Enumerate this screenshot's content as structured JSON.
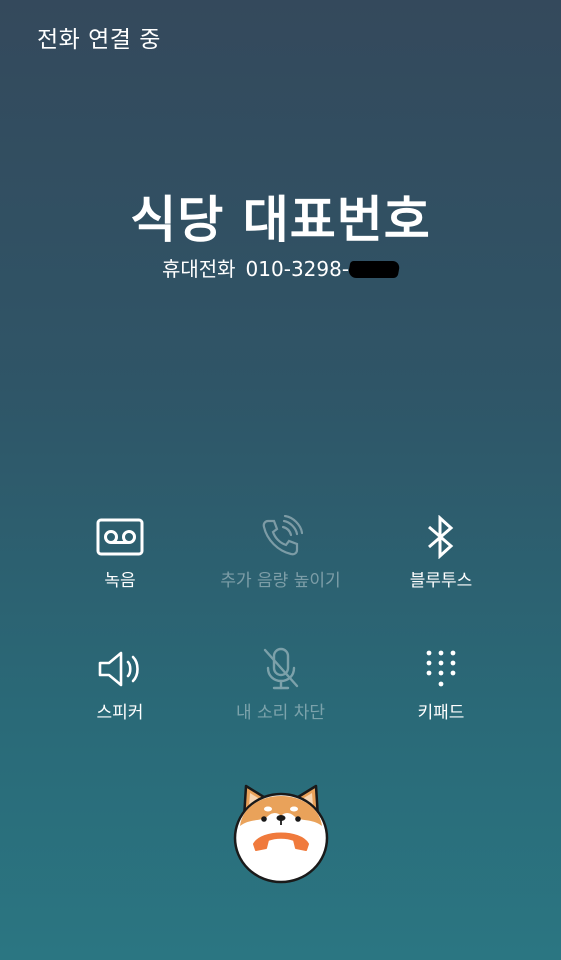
{
  "status": {
    "text": "전화 연결 중"
  },
  "caller": {
    "name": "식당 대표번호",
    "line_type": "휴대전화",
    "number_visible": "010-3298-"
  },
  "controls": [
    {
      "id": "record",
      "label": "녹음",
      "icon": "voicemail-icon",
      "enabled": true
    },
    {
      "id": "volume-boost",
      "label": "추가 음량 높이기",
      "icon": "phone-volume-icon",
      "enabled": false
    },
    {
      "id": "bluetooth",
      "label": "블루투스",
      "icon": "bluetooth-icon",
      "enabled": true
    },
    {
      "id": "speaker",
      "label": "스피커",
      "icon": "speaker-icon",
      "enabled": true
    },
    {
      "id": "mute",
      "label": "내 소리 차단",
      "icon": "mic-off-icon",
      "enabled": false
    },
    {
      "id": "keypad",
      "label": "키패드",
      "icon": "dialpad-icon",
      "enabled": true
    }
  ],
  "end_call": {
    "icon": "shiba-dog-end-call-icon",
    "accent": "#f07a3c"
  },
  "colors": {
    "bg_top": "#34495c",
    "bg_bottom": "#2b7682",
    "text": "#ffffff"
  }
}
